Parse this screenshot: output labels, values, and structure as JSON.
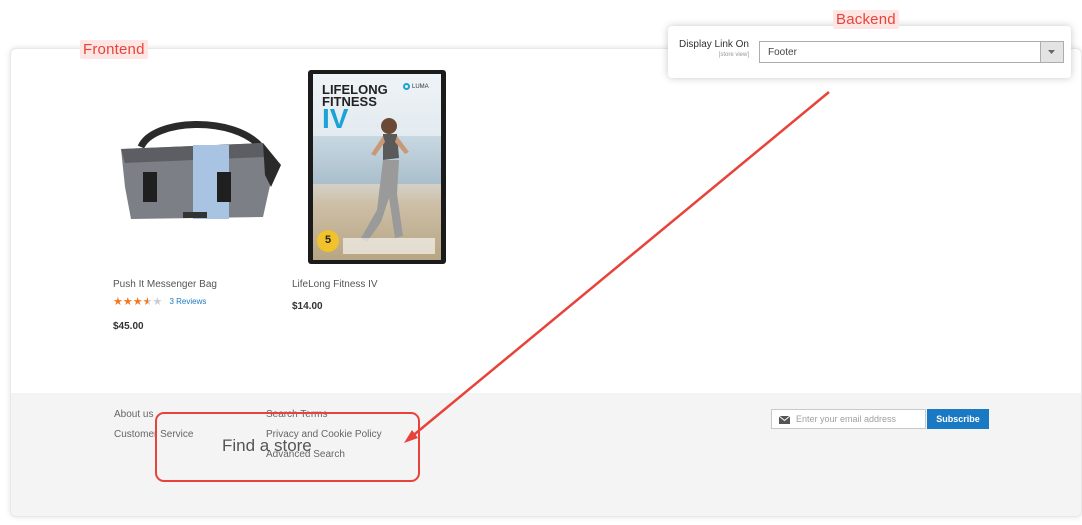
{
  "labels": {
    "frontend": "Frontend",
    "backend": "Backend"
  },
  "products": [
    {
      "name": "Push It Messenger Bag",
      "rating_stars": 3.5,
      "rating_max": 5,
      "reviews": "3  Reviews",
      "price": "$45.00",
      "image_icon": "messenger-bag-image"
    },
    {
      "name": "LifeLong Fitness IV",
      "price": "$14.00",
      "image_icon": "fitness-dvd-cover-image",
      "cover": {
        "title_line1": "LIFELONG",
        "title_line2": "FITNESS",
        "title_line3": "IV",
        "brand": "LUMA",
        "badge": "5"
      }
    }
  ],
  "footer": {
    "links_col1": [
      "About us",
      "Customer Service"
    ],
    "links_col2": [
      "Search Terms",
      "Privacy and Cookie Policy",
      "Advanced Search"
    ],
    "find_store": "Find a store",
    "newsletter": {
      "placeholder": "Enter your email address",
      "button": "Subscribe",
      "icon": "envelope-icon"
    }
  },
  "backend": {
    "field_label": "Display Link On",
    "scope": "[store view]",
    "selected_value": "Footer",
    "icon": "chevron-down-icon"
  },
  "colors": {
    "annotation_red": "#e8433a",
    "link_blue": "#1979c3",
    "star_orange": "#f4781e",
    "footer_bg": "#f4f4f4"
  }
}
